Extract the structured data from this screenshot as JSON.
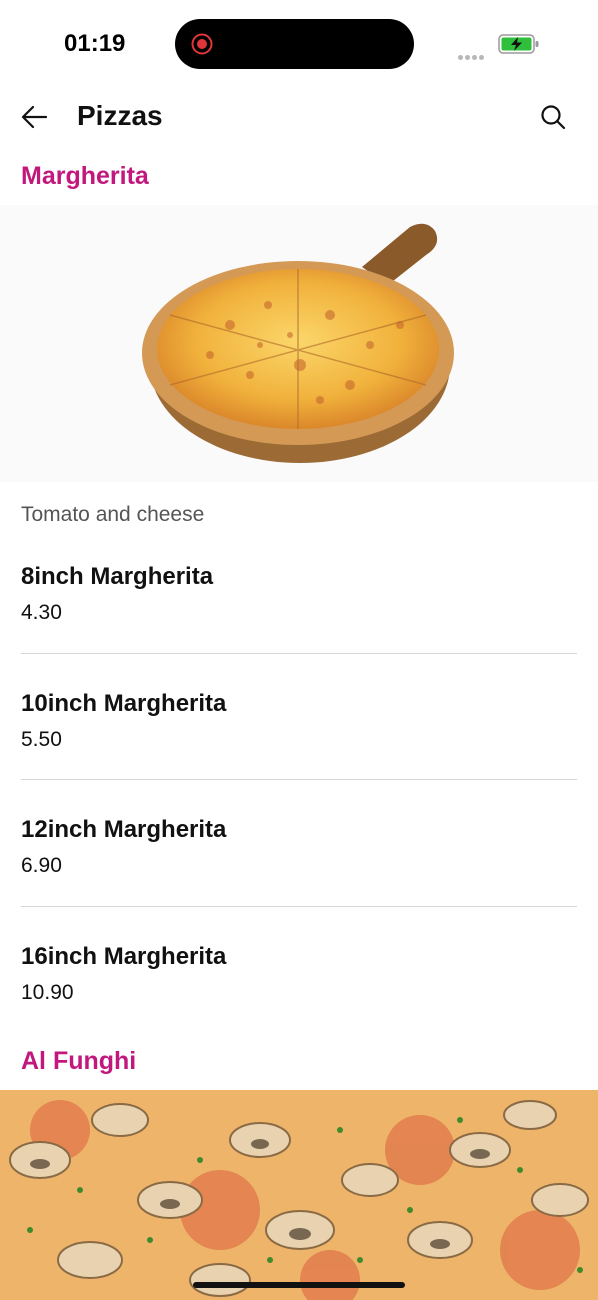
{
  "status_bar": {
    "time": "01:19"
  },
  "header": {
    "title": "Pizzas"
  },
  "sections": [
    {
      "title": "Margherita",
      "description": "Tomato and cheese",
      "items": [
        {
          "name": "8inch Margherita",
          "price": "4.30"
        },
        {
          "name": "10inch Margherita",
          "price": "5.50"
        },
        {
          "name": "12inch Margherita",
          "price": "6.90"
        },
        {
          "name": "16inch Margherita",
          "price": "10.90"
        }
      ]
    },
    {
      "title": "Al Funghi"
    }
  ],
  "colors": {
    "accent": "#c2187e",
    "battery": "#2fbf3a",
    "record": "#e0353b"
  },
  "icons": [
    "back-arrow-icon",
    "search-icon",
    "record-icon",
    "battery-charging-icon"
  ]
}
